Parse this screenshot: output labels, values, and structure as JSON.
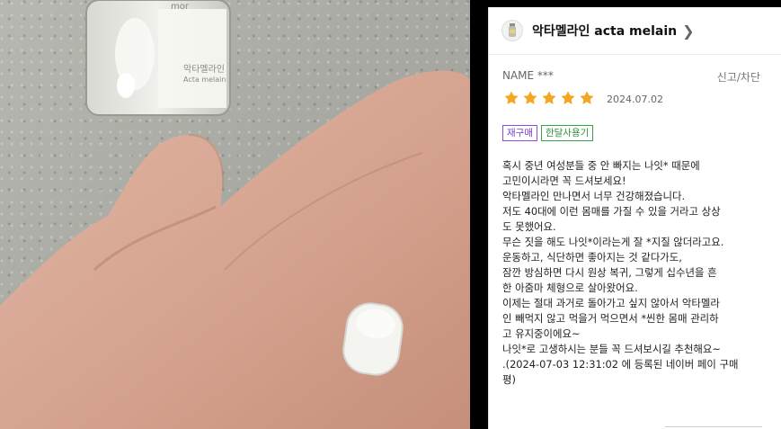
{
  "product": {
    "title": "악타멜라인 acta melain",
    "icon": "product-bottle-icon"
  },
  "reviewer": {
    "name": "NAME ***",
    "report_label": "신고/차단"
  },
  "review": {
    "rating": 5,
    "date": "2024.07.02",
    "badges": [
      "재구매",
      "한달사용기"
    ],
    "lines": [
      "혹시 중년 여성분들 중 안 빠지는 나잇* 때문에",
      "고민이시라면 꼭 드셔보세요!",
      "악타멜라인 만나면서 너무 건강해졌습니다.",
      "저도 40대에 이런 몸매를 가질 수 있을 거라고 상상",
      "도 못했어요.",
      "무슨 짓을 해도 나잇*이라는게 잘 *지질 않더라고요.",
      "운동하고, 식단하면 좋아지는 것 같다가도,",
      "잠깐 방심하면 다시 원상 복귀, 그렇게 십수년을 흔",
      "한 아줌마 체형으로 살아왔어요.",
      "이제는 절대 과거로 돌아가고 싶지 않아서 악타멜라",
      "인 빼먹지 않고 먹을거 먹으면서 *씬한 몸매 관리하",
      "고 유지중이에요~",
      "나잇*로 고생하시는 분들 꼭 드셔보시길 추천해요~",
      ".(2024-07-03 12:31:02 에 등록된 네이버 페이 구매",
      "평)"
    ]
  },
  "photo": {
    "bottle_label": "악타멜라인",
    "bottle_sublabel": "Acta melain",
    "bottle_brand": "mor"
  },
  "colors": {
    "star": "#f5a623",
    "repurchase_badge": "#7b3ed0",
    "month_badge": "#2d8f3b"
  }
}
